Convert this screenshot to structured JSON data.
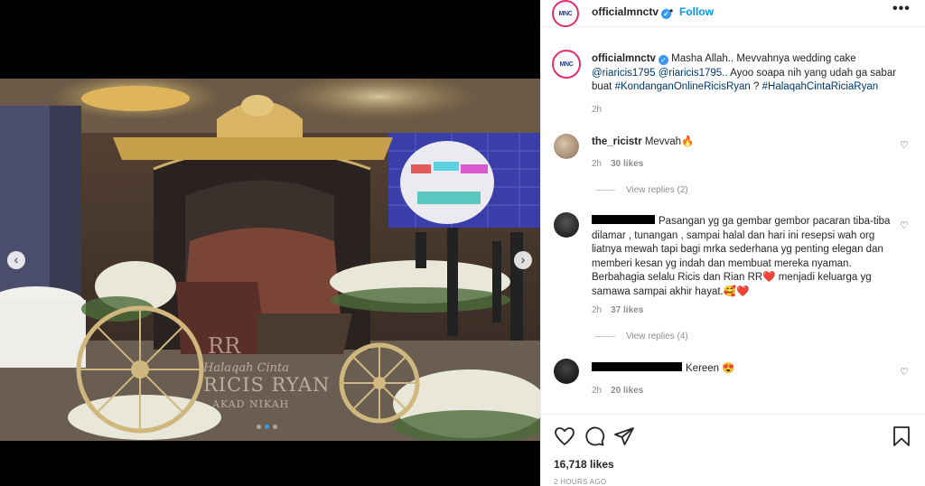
{
  "post": {
    "username": "officialmnctv",
    "follow_label": "Follow",
    "dot": "•",
    "more_label": "•••",
    "avatar_logo": "MNC"
  },
  "caption": {
    "username": "officialmnctv",
    "text_1": "Masha Allah.. Mevvahnya wedding cake",
    "mention_1": "@riaricis1795",
    "mention_2": "@riaricis1795..",
    "text_2": "Ayoo soapa nih yang udah ga sabar buat",
    "hashtag_1": "#KondanganOnlineRicisRyan",
    "text_3": "?",
    "hashtag_2": "#HalaqahCintaRiciaRyan",
    "time": "2h"
  },
  "comments": [
    {
      "username": "the_ricistr",
      "text": "Mevvah🔥",
      "time": "2h",
      "likes": "30 likes",
      "view_replies": "View replies (2)"
    },
    {
      "username": "",
      "text": "Pasangan yg ga gembar gembor pacaran tiba-tiba dilamar , tunangan , sampai halal dan hari ini resepsi wah org liatnya mewah tapi bagi mrka sederhana yg penting elegan dan memberi kesan yg indah dan membuat mereka nyaman. Berbahagia selalu Ricis dan Rian RR❤️ menjadi keluarga yg samawa sampai akhir hayat.🥰❤️",
      "time": "2h",
      "likes": "37 likes",
      "view_replies": "View replies (4)"
    },
    {
      "username": "",
      "text": "Kereen 😍",
      "time": "2h",
      "likes": "20 likes"
    }
  ],
  "actions": {
    "likes_count": "16,718 likes",
    "time_ago": "2 HOURS AGO"
  },
  "media": {
    "carousel_left": "‹",
    "carousel_right": "›",
    "carousel_count": 3,
    "carousel_active": 1,
    "watermark_line_1": "RR",
    "watermark_line_2": "Halaqah Cinta",
    "watermark_line_3": "RICIS RYAN",
    "watermark_line_4": "AKAD NIKAH"
  },
  "icons": [
    "heart-icon",
    "comment-icon",
    "share-icon",
    "bookmark-icon",
    "verified-icon",
    "more-icon"
  ],
  "colors": {
    "accent": "#0095f6",
    "verified": "#3897f0",
    "link": "#00376b",
    "muted": "#8e8e8e"
  }
}
